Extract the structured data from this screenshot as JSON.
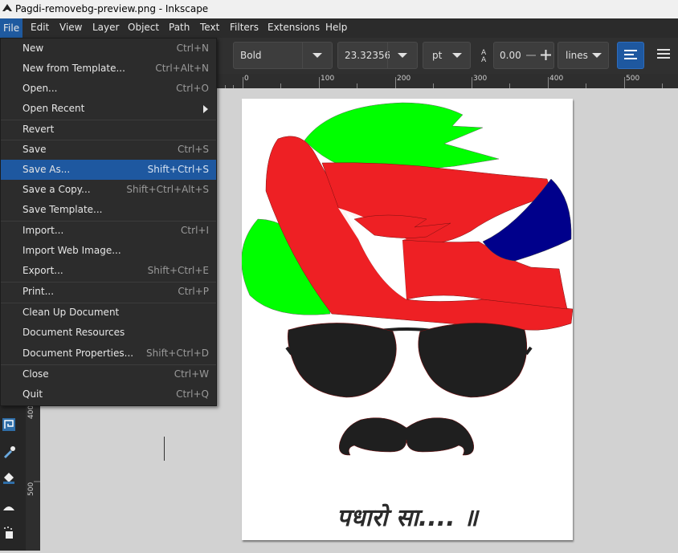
{
  "window": {
    "title": "Pagdi-removebg-preview.png - Inkscape"
  },
  "menubar": [
    {
      "label": "File",
      "active": true
    },
    {
      "label": "Edit"
    },
    {
      "label": "View"
    },
    {
      "label": "Layer"
    },
    {
      "label": "Object"
    },
    {
      "label": "Path"
    },
    {
      "label": "Text"
    },
    {
      "label": "Filters"
    },
    {
      "label": "Extensions"
    },
    {
      "label": "Help"
    }
  ],
  "toolbar": {
    "font_style": "Bold",
    "font_size": "23.32356",
    "unit": "pt",
    "letter_spacing": "0.00",
    "spacing_mode": "lines"
  },
  "ruler": {
    "labels": [
      "0",
      "100",
      "200",
      "300",
      "400",
      "500"
    ]
  },
  "file_menu": {
    "items": [
      {
        "label": "New",
        "shortcut": "Ctrl+N"
      },
      {
        "label": "New from Template...",
        "shortcut": "Ctrl+Alt+N"
      },
      {
        "label": "Open...",
        "shortcut": "Ctrl+O"
      },
      {
        "label": "Open Recent",
        "shortcut": "",
        "submenu": true
      },
      {
        "label": "Revert",
        "shortcut": ""
      },
      {
        "label": "Save",
        "shortcut": "Ctrl+S"
      },
      {
        "label": "Save As...",
        "shortcut": "Shift+Ctrl+S",
        "highlighted": true
      },
      {
        "label": "Save a Copy...",
        "shortcut": "Shift+Ctrl+Alt+S"
      },
      {
        "label": "Save Template...",
        "shortcut": ""
      },
      {
        "label": "Import...",
        "shortcut": "Ctrl+I"
      },
      {
        "label": "Import Web Image...",
        "shortcut": ""
      },
      {
        "label": "Export...",
        "shortcut": "Shift+Ctrl+E"
      },
      {
        "label": "Print...",
        "shortcut": "Ctrl+P"
      },
      {
        "label": "Clean Up Document",
        "shortcut": ""
      },
      {
        "label": "Document Resources",
        "shortcut": ""
      },
      {
        "label": "Document Properties...",
        "shortcut": "Shift+Ctrl+D"
      },
      {
        "label": "Close",
        "shortcut": "Ctrl+W"
      },
      {
        "label": "Quit",
        "shortcut": "Ctrl+Q"
      }
    ]
  },
  "canvas": {
    "caption": "पधारो सा.... ॥"
  },
  "colors": {
    "turban_red": "#ee2024",
    "turban_green": "#00ff00",
    "turban_blue": "#00008b",
    "glasses": "#1f1f1f",
    "menu_highlight": "#1e58a0"
  }
}
